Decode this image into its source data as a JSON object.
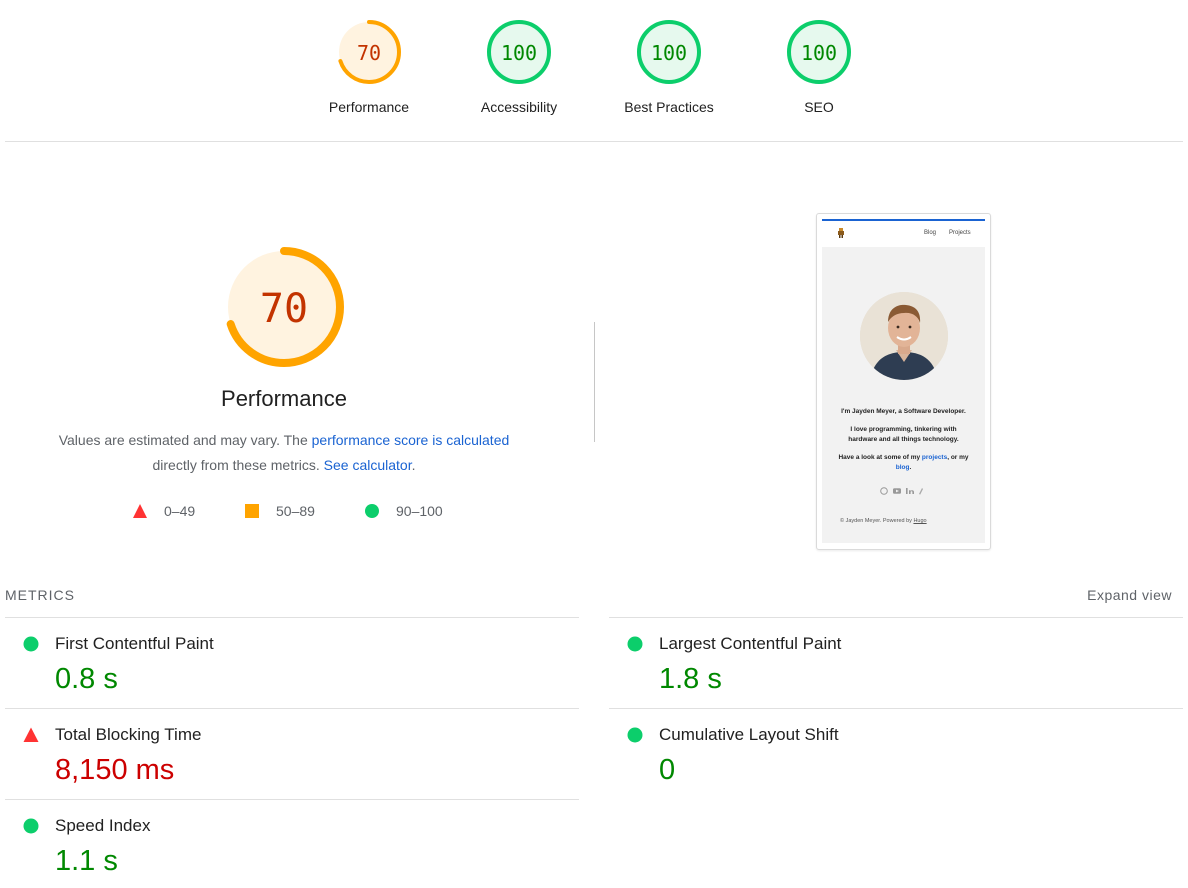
{
  "gauges": [
    {
      "label": "Performance",
      "score": "70",
      "fraction": 0.7,
      "color": "#ffa400",
      "bg": "#fff3e0",
      "text": "#c33300"
    },
    {
      "label": "Accessibility",
      "score": "100",
      "fraction": 1.0,
      "color": "#0cce6b",
      "bg": "#e6f9ee",
      "text": "#008800"
    },
    {
      "label": "Best Practices",
      "score": "100",
      "fraction": 1.0,
      "color": "#0cce6b",
      "bg": "#e6f9ee",
      "text": "#008800"
    },
    {
      "label": "SEO",
      "score": "100",
      "fraction": 1.0,
      "color": "#0cce6b",
      "bg": "#e6f9ee",
      "text": "#008800"
    }
  ],
  "performance": {
    "score": "70",
    "fraction": 0.7,
    "title": "Performance",
    "desc_part1": "Values are estimated and may vary. The ",
    "desc_link1": "performance score is calculated",
    "desc_part2": " directly from these metrics. ",
    "desc_link2": "See calculator",
    "desc_part3": "."
  },
  "legend": [
    {
      "shape": "triangle",
      "range": "0–49",
      "color": "#ff3333"
    },
    {
      "shape": "square",
      "range": "50–89",
      "color": "#ffa400"
    },
    {
      "shape": "circle",
      "range": "90–100",
      "color": "#0cce6b"
    }
  ],
  "thumbnail": {
    "nav_blog": "Blog",
    "nav_projects": "Projects",
    "intro": "I'm Jayden Meyer, a Software Developer.",
    "line2a": "I love programming, tinkering with",
    "line2b": "hardware and all things technology.",
    "line3a": "Have a look at some of my ",
    "line3_link1": "projects",
    "line3b": ", or my",
    "line3_link2": "blog",
    "line3c": ".",
    "footer_text": "© Jayden Meyer. Powered by ",
    "footer_link": "Hugo"
  },
  "metrics": {
    "header": "METRICS",
    "expand": "Expand view",
    "items": [
      {
        "title": "First Contentful Paint",
        "value": "0.8 s",
        "status": "good"
      },
      {
        "title": "Largest Contentful Paint",
        "value": "1.8 s",
        "status": "good"
      },
      {
        "title": "Total Blocking Time",
        "value": "8,150 ms",
        "status": "bad"
      },
      {
        "title": "Cumulative Layout Shift",
        "value": "0",
        "status": "good"
      },
      {
        "title": "Speed Index",
        "value": "1.1 s",
        "status": "good"
      }
    ]
  }
}
